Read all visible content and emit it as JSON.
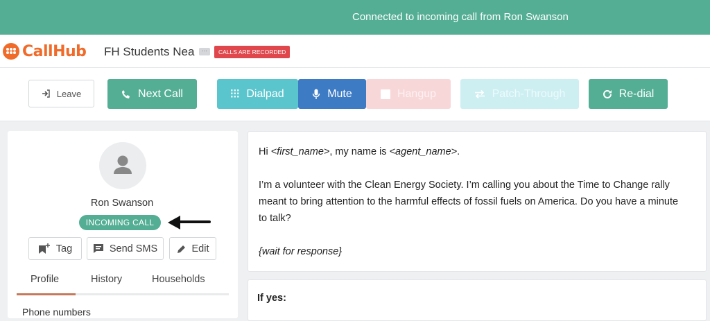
{
  "banner": {
    "text": "Connected to incoming call from Ron Swanson"
  },
  "header": {
    "logo_text": "CallHub",
    "campaign_name": "FH Students Nea",
    "more_label": "···",
    "recorded_badge": "CALLS ARE RECORDED"
  },
  "toolbar": {
    "leave": "Leave",
    "next_call": "Next Call",
    "dialpad": "Dialpad",
    "mute": "Mute",
    "hangup": "Hangup",
    "patch_through": "Patch-Through",
    "redial": "Re-dial"
  },
  "contact": {
    "name": "Ron Swanson",
    "status": "INCOMING CALL",
    "actions": {
      "tag": "Tag",
      "send_sms": "Send SMS",
      "edit": "Edit"
    },
    "tabs": [
      "Profile",
      "History",
      "Households"
    ],
    "active_tab": "Profile",
    "section_label": "Phone numbers"
  },
  "script": {
    "greeting_hi": "Hi ",
    "first_name_token": "<first_name>",
    "greeting_mid": ", my name is ",
    "agent_name_token": "<agent_name>",
    "greeting_end": ".",
    "paragraph": "I’m a volunteer with the Clean Energy Society. I’m calling you about the Time to Change rally meant to bring attention to the harmful effects of fossil fuels on America. Do you have a minute to talk?",
    "instruction": "{wait for response}",
    "if_yes_label": "If yes:"
  },
  "colors": {
    "banner": "#54ae94",
    "brand": "#f06b2a",
    "recorded": "#e0474c",
    "dialpad": "#5bc5cd",
    "mute": "#3d7bc4",
    "hangup_disabled": "#f8d7d9",
    "patch_disabled": "#cdeff2",
    "active_tab": "#c4795a"
  }
}
